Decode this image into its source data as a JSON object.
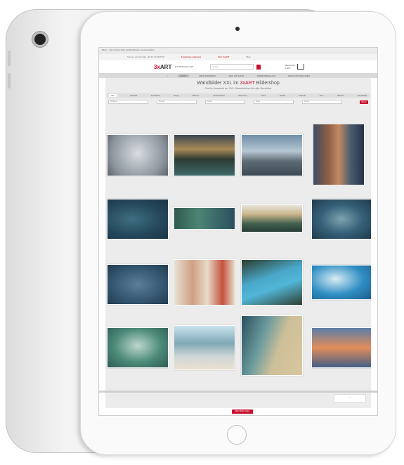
{
  "browser": {
    "url": "Bilder - https://www.3dart.de/Wandbilder-Gesamtkatalog"
  },
  "topbar": {
    "service": "Service und Kontakt +49 36 73 9625 06",
    "delivery": "Kostenlose Lieferung",
    "about": "Über 3xART",
    "blog": "Blog"
  },
  "brand": {
    "logo_prefix": "3x",
    "logo_main": "ART",
    "tagline": "ANYTIME MAY ART"
  },
  "search": {
    "placeholder": "Suche"
  },
  "cart": {
    "label": "Warenkorb 0,00 €"
  },
  "nav": {
    "items": [
      "SHOP",
      "MEIN WANDBILD",
      "WAS IST 3xART",
      "PREISVERGLEICH",
      "GESCHÄFTSKUNDEN"
    ]
  },
  "headline": {
    "before": "Wandbilder XXL im ",
    "brand": "3xART",
    "after": " Bildershop",
    "sub": "Große Auswahl an XXL Wandbildern für alle Bereiche"
  },
  "categories": [
    "Alle",
    "Abstrakt",
    "Architektur",
    "Berge",
    "Blumen",
    "Landschaften",
    "Menschen",
    "Natur",
    "Städte",
    "Strände",
    "Tiere",
    "Wasser",
    "Wandbilder"
  ],
  "filters": [
    "Sortieren",
    "Format",
    "Farbe",
    "Motiv",
    "Suche"
  ],
  "filter_button": "Filtern",
  "more_button": "Mehr Bilder laden",
  "top_button": "⌃",
  "colors": {
    "accent": "#c8102e"
  }
}
